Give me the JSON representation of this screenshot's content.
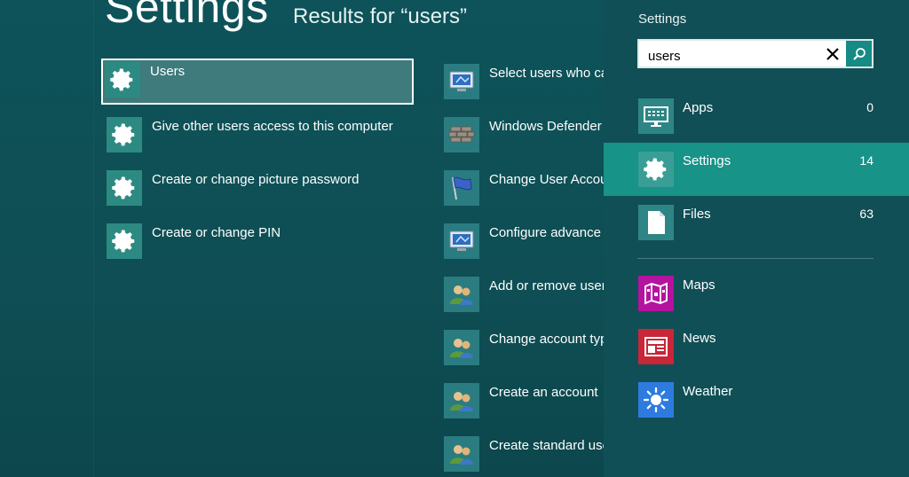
{
  "page": {
    "heading": "Settings",
    "results_label": "Results for “users”"
  },
  "results_left": [
    {
      "label": "Users",
      "icon": "gear-icon",
      "selected": true
    },
    {
      "label": "Give other users access to this computer",
      "icon": "gear-icon"
    },
    {
      "label": "Create or change picture password",
      "icon": "gear-icon"
    },
    {
      "label": "Create or change PIN",
      "icon": "gear-icon"
    }
  ],
  "results_right": [
    {
      "label": "Select users who ca",
      "icon": "monitor-icon"
    },
    {
      "label": "Windows Defender",
      "icon": "brick-wall-icon"
    },
    {
      "label": "Change User Accou",
      "icon": "flag-icon"
    },
    {
      "label": "Configure advance",
      "icon": "monitor-icon"
    },
    {
      "label": "Add or remove user",
      "icon": "users-icon"
    },
    {
      "label": "Change account typ",
      "icon": "users-icon"
    },
    {
      "label": "Create an account",
      "icon": "users-icon"
    },
    {
      "label": "Create standard use",
      "icon": "users-icon"
    }
  ],
  "charm": {
    "title": "Settings",
    "search_value": "users",
    "scopes": [
      {
        "label": "Apps",
        "count": "0",
        "icon": "apps-keyboard-icon",
        "color": "#2e8585"
      },
      {
        "label": "Settings",
        "count": "14",
        "icon": "gear-icon",
        "color": "#3a9e96",
        "active": true
      },
      {
        "label": "Files",
        "count": "63",
        "icon": "file-icon",
        "color": "#2e8585"
      }
    ],
    "apps": [
      {
        "label": "Maps",
        "icon": "maps-icon",
        "color": "#b4139f"
      },
      {
        "label": "News",
        "icon": "news-icon",
        "color": "#c92638"
      },
      {
        "label": "Weather",
        "icon": "weather-sun-icon",
        "color": "#2e7be0"
      }
    ]
  },
  "colors": {
    "background": "#0f4f55",
    "accent": "#179388",
    "selected_tile": "#3f7a7c"
  }
}
